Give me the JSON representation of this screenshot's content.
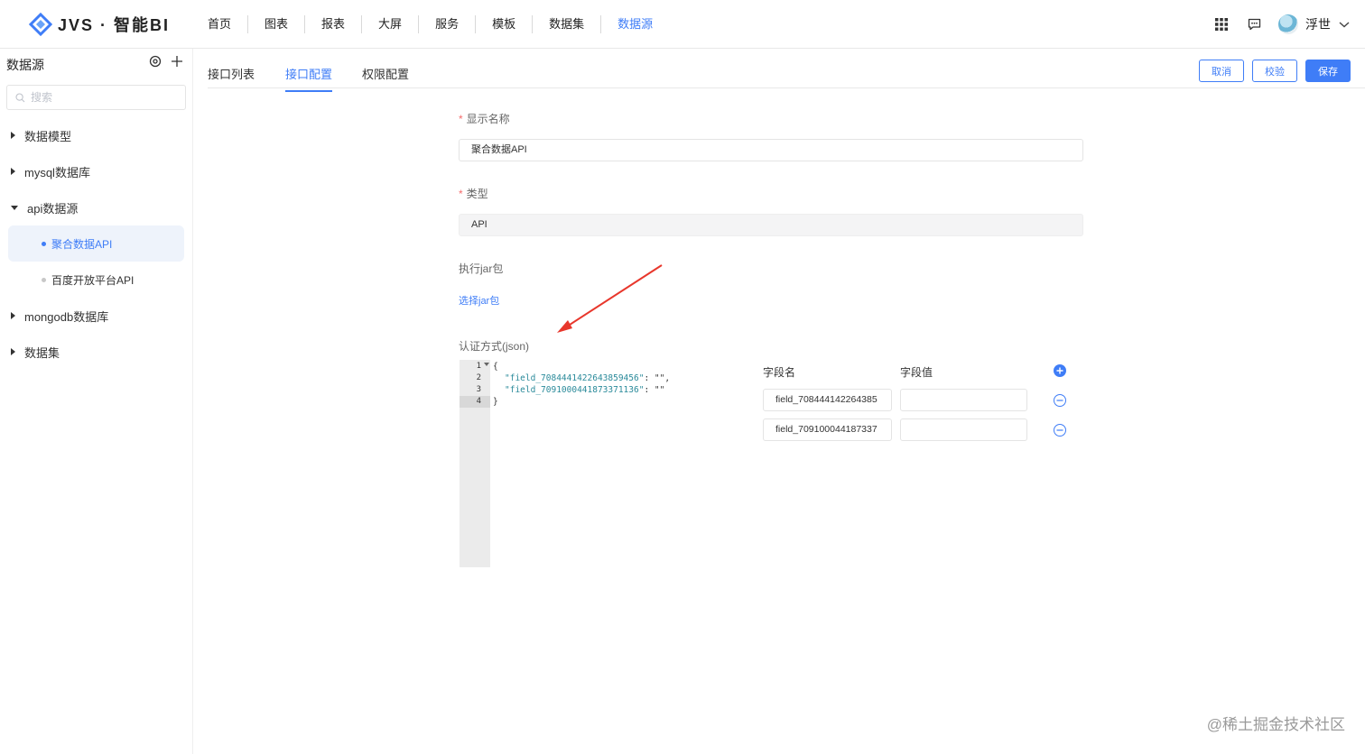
{
  "app": {
    "logo_text": "JVS · 智能BI"
  },
  "nav": {
    "items": [
      {
        "label": "首页"
      },
      {
        "label": "图表"
      },
      {
        "label": "报表"
      },
      {
        "label": "大屏"
      },
      {
        "label": "服务"
      },
      {
        "label": "模板"
      },
      {
        "label": "数据集"
      },
      {
        "label": "数据源"
      }
    ],
    "active_index": 7
  },
  "user": {
    "name": "浮世"
  },
  "sidebar": {
    "title": "数据源",
    "search_placeholder": "搜索",
    "tree": [
      {
        "label": "数据模型"
      },
      {
        "label": "mysql数据库"
      },
      {
        "label": "api数据源",
        "children": [
          {
            "label": "聚合数据API",
            "active": true
          },
          {
            "label": "百度开放平台API"
          }
        ]
      },
      {
        "label": "mongodb数据库"
      },
      {
        "label": "数据集"
      }
    ]
  },
  "tabs": {
    "items": [
      {
        "label": "接口列表"
      },
      {
        "label": "接口配置"
      },
      {
        "label": "权限配置"
      }
    ],
    "active_index": 1
  },
  "actions": {
    "cancel": "取消",
    "verify": "校验",
    "save": "保存"
  },
  "form": {
    "display_name_label": "显示名称",
    "display_name_value": "聚合数据API",
    "type_label": "类型",
    "type_value": "API",
    "jar_label": "执行jar包",
    "jar_link": "选择jar包",
    "auth_label": "认证方式(json)"
  },
  "editor": {
    "line_numbers": [
      "1",
      "2",
      "3",
      "4"
    ],
    "lines": [
      {
        "text": "{"
      },
      {
        "key": "\"field_7084441422643859456\"",
        "rest": ": \"\","
      },
      {
        "key": "\"field_7091000441873371136\"",
        "rest": ": \"\""
      },
      {
        "text": "}"
      }
    ]
  },
  "fields": {
    "name_header": "字段名",
    "value_header": "字段值",
    "rows": [
      {
        "name": "field_708444142264385",
        "value": ""
      },
      {
        "name": "field_709100044187337",
        "value": ""
      }
    ]
  },
  "colors": {
    "accent": "#3f7df7",
    "annotation_arrow": "#e8372c"
  },
  "watermark": "@稀土掘金技术社区"
}
